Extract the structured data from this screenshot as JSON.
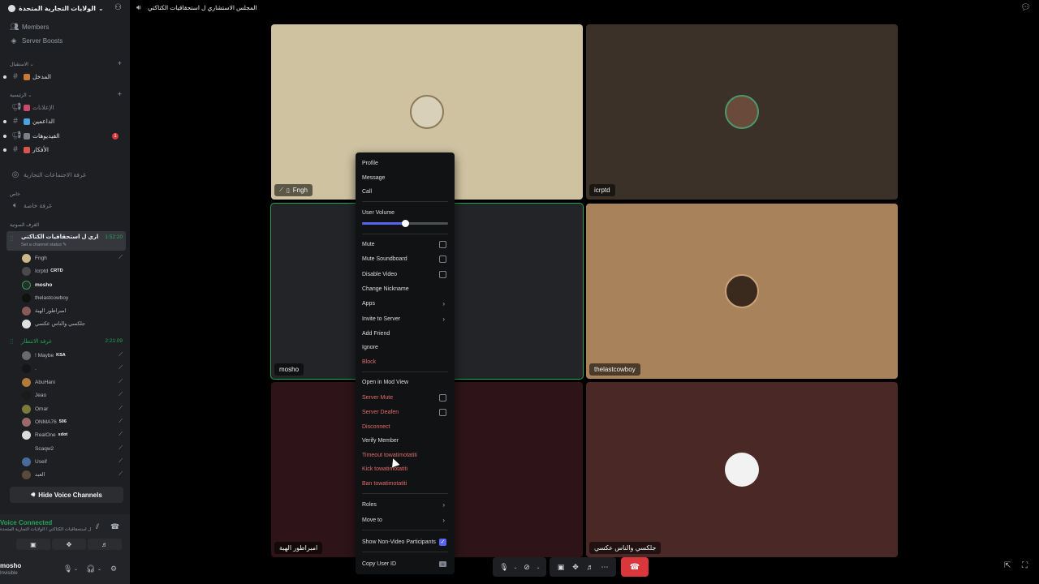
{
  "server": {
    "name": "الولايات التجارية المتحدة"
  },
  "nav": {
    "members": "Members",
    "boosts": "Server Boosts"
  },
  "categories": {
    "entrance": "الاستقبال",
    "main": "الرئيسية",
    "private": "خاص",
    "voice": "الغرف الصوتية"
  },
  "channels": {
    "entrance": "المدخل",
    "announcements": "الإعلانات",
    "supporters": "الداعمين",
    "videos": "الفيديوهات",
    "ideas": "الأفكار",
    "meeting": "غرفة الاجتماعات التجارية",
    "private_room": "غرفة خاصة",
    "unread_badge": "1"
  },
  "voice_channel": {
    "name": "المجلس الاستشاري ل استحقاقيات الكتاكتي",
    "time": "1:52:20",
    "status": "Set a channel status",
    "members": [
      {
        "name": "Fngh",
        "tag": ""
      },
      {
        "name": "Icrptd",
        "tag": "CRTD"
      },
      {
        "name": "mosho",
        "tag": ""
      },
      {
        "name": "thelastcowboy",
        "tag": ""
      },
      {
        "name": "امبراطور الهبة",
        "tag": ""
      },
      {
        "name": "جلكسي والناس عكسي",
        "tag": ""
      }
    ]
  },
  "waiting_room": {
    "name": "غرفة الانتظار",
    "time": "2:21:09",
    "members": [
      {
        "name": "! Maybe",
        "tag": "KSA"
      },
      {
        "name": ".",
        "tag": ""
      },
      {
        "name": "AbuHani",
        "tag": ""
      },
      {
        "name": "Jeao",
        "tag": ""
      },
      {
        "name": "Omar",
        "tag": ""
      },
      {
        "name": "ONMA76",
        "tag": "506"
      },
      {
        "name": "RealOne",
        "tag": "sdot"
      },
      {
        "name": "Scaqw2",
        "tag": ""
      },
      {
        "name": "Useif",
        "tag": ""
      },
      {
        "name": "العبد",
        "tag": ""
      }
    ]
  },
  "hide_voice": "Hide Voice Channels",
  "voice_panel": {
    "status": "Voice Connected",
    "path": "المجلس الاستشاري ل استحقاقيات الكتاكتي / الولايات التجارية المتحدة"
  },
  "user": {
    "name": "mosho",
    "status": "Invisible"
  },
  "topbar": {
    "title": "المجلس الاستشاري ل استحقاقيات الكتاكتي"
  },
  "tiles": {
    "t1": "Fngh",
    "t2": "icrptd",
    "t3": "mosho",
    "t4": "thelastcowboy",
    "t5": "امبراطور الهبة",
    "t6": "جلكسي والناس عكسي"
  },
  "menu": {
    "profile": "Profile",
    "message": "Message",
    "call": "Call",
    "user_volume": "User Volume",
    "volume_level": 0.5,
    "mute": "Mute",
    "mute_soundboard": "Mute Soundboard",
    "disable_video": "Disable Video",
    "change_nickname": "Change Nickname",
    "apps": "Apps",
    "invite": "Invite to Server",
    "add_friend": "Add Friend",
    "ignore": "Ignore",
    "block": "Block",
    "mod_view": "Open in Mod View",
    "server_mute": "Server Mute",
    "server_deafen": "Server Deafen",
    "disconnect": "Disconnect",
    "verify": "Verify Member",
    "timeout": "Timeout towatimotatiti",
    "kick": "Kick towatimotatiti",
    "ban": "Ban towatimotatiti",
    "roles": "Roles",
    "move_to": "Move to",
    "show_non_video": "Show Non-Video Participants",
    "copy_id": "Copy User ID",
    "id_badge": "ID"
  },
  "colors": {
    "accent": "#5865f2",
    "online": "#23a55a",
    "danger": "#da373c"
  }
}
